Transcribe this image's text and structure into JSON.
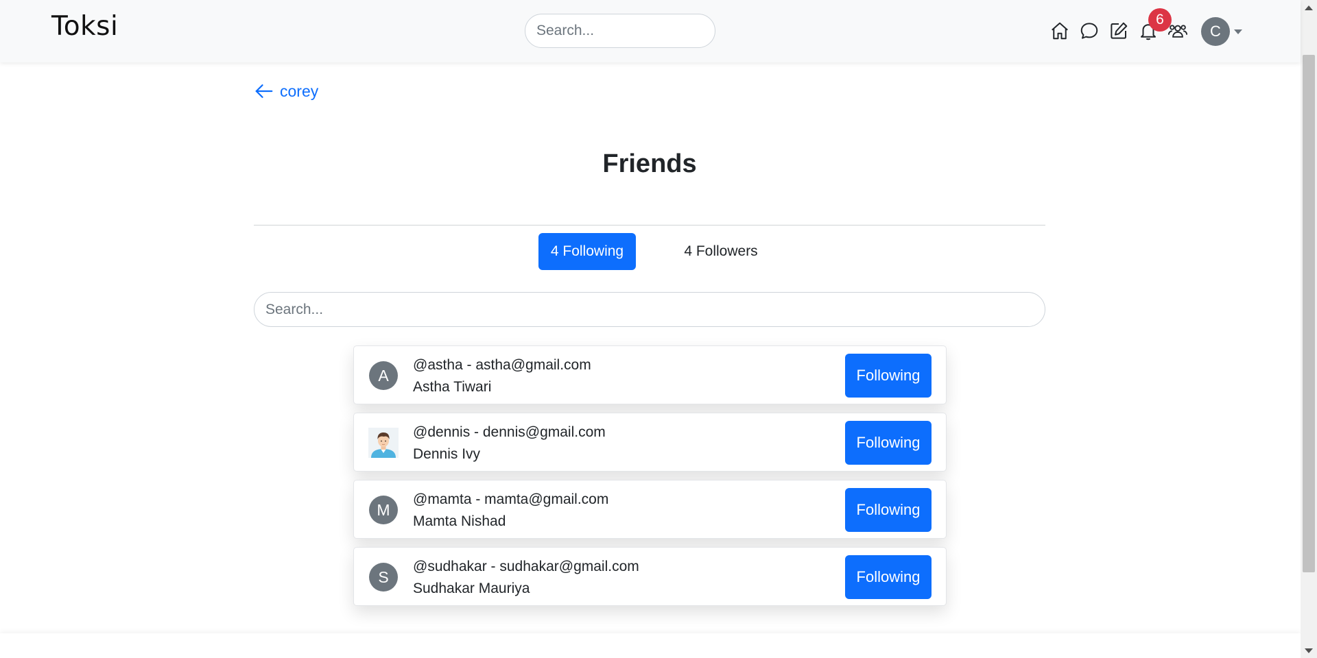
{
  "navbar": {
    "brand": "Toksi",
    "search_placeholder": "Search...",
    "icons": [
      "home-icon",
      "chat-icon",
      "edit-icon",
      "bell-icon",
      "friends-icon"
    ],
    "notification_count": "6",
    "user_initial": "C"
  },
  "back": {
    "label": "corey"
  },
  "page": {
    "title": "Friends"
  },
  "tabs": {
    "following": "4 Following",
    "followers": "4 Followers"
  },
  "list_search": {
    "placeholder": "Search..."
  },
  "friends": [
    {
      "handle": "@astha - astha@gmail.com",
      "name": "Astha Tiwari",
      "initial": "A",
      "button": "Following"
    },
    {
      "handle": "@dennis - dennis@gmail.com",
      "name": "Dennis Ivy",
      "initial": "",
      "button": "Following"
    },
    {
      "handle": "@mamta - mamta@gmail.com",
      "name": "Mamta Nishad",
      "initial": "M",
      "button": "Following"
    },
    {
      "handle": "@sudhakar - sudhakar@gmail.com",
      "name": "Sudhakar Mauriya",
      "initial": "S",
      "button": "Following"
    }
  ],
  "colors": {
    "accent": "#0d6efd",
    "badge": "#dc3545",
    "avatar": "#6c757d"
  }
}
